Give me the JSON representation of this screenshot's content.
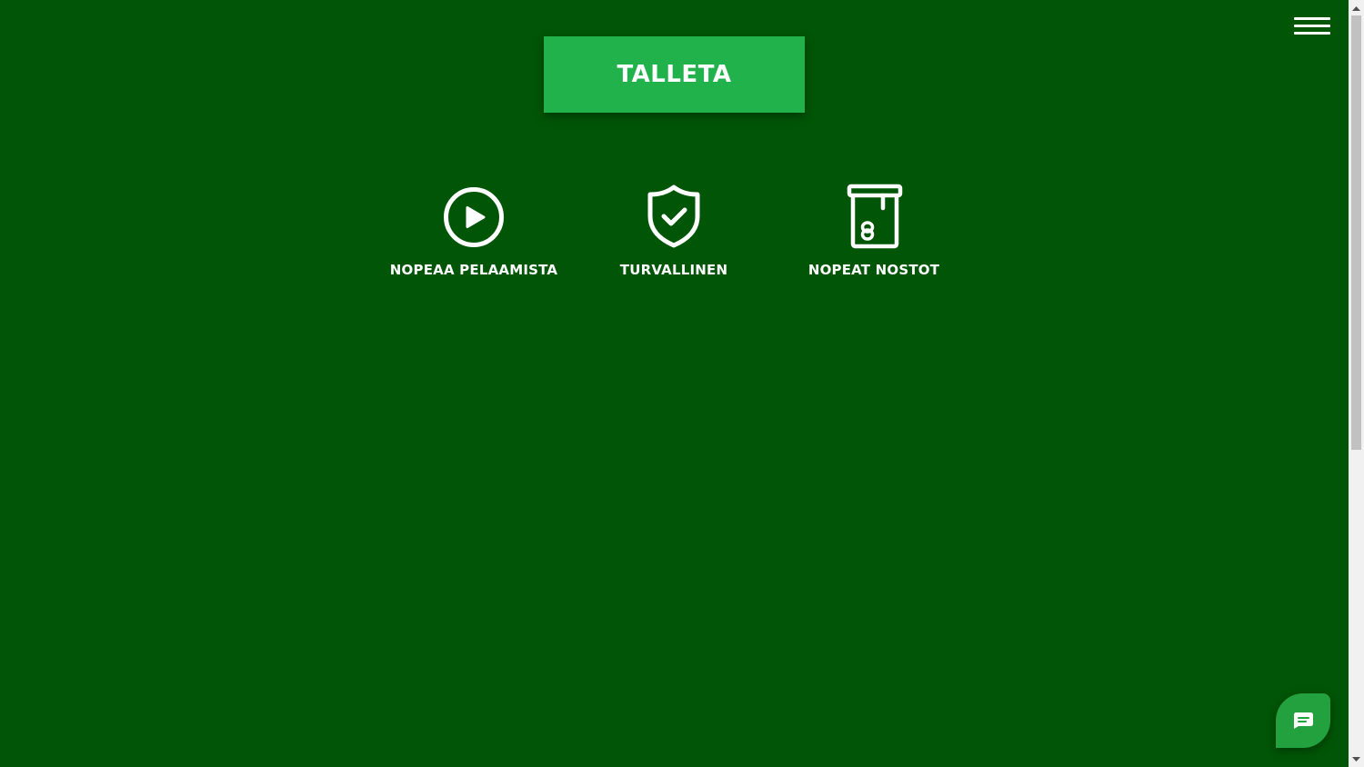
{
  "header": {
    "deposit_label": "TALLETA",
    "menu_icon": "hamburger-menu-icon"
  },
  "features": [
    {
      "label": "NOPEAA PELAAMISTA",
      "icon": "play-circle-icon"
    },
    {
      "label": "TURVALLINEN",
      "icon": "shield-check-icon"
    },
    {
      "label": "NOPEAT NOSTOT",
      "icon": "cash-withdrawal-icon"
    }
  ],
  "chat": {
    "icon": "chat-bubble-icon"
  },
  "colors": {
    "background": "#005506",
    "accent": "#22b24c",
    "chat": "#22a13e",
    "text": "#ffffff"
  }
}
